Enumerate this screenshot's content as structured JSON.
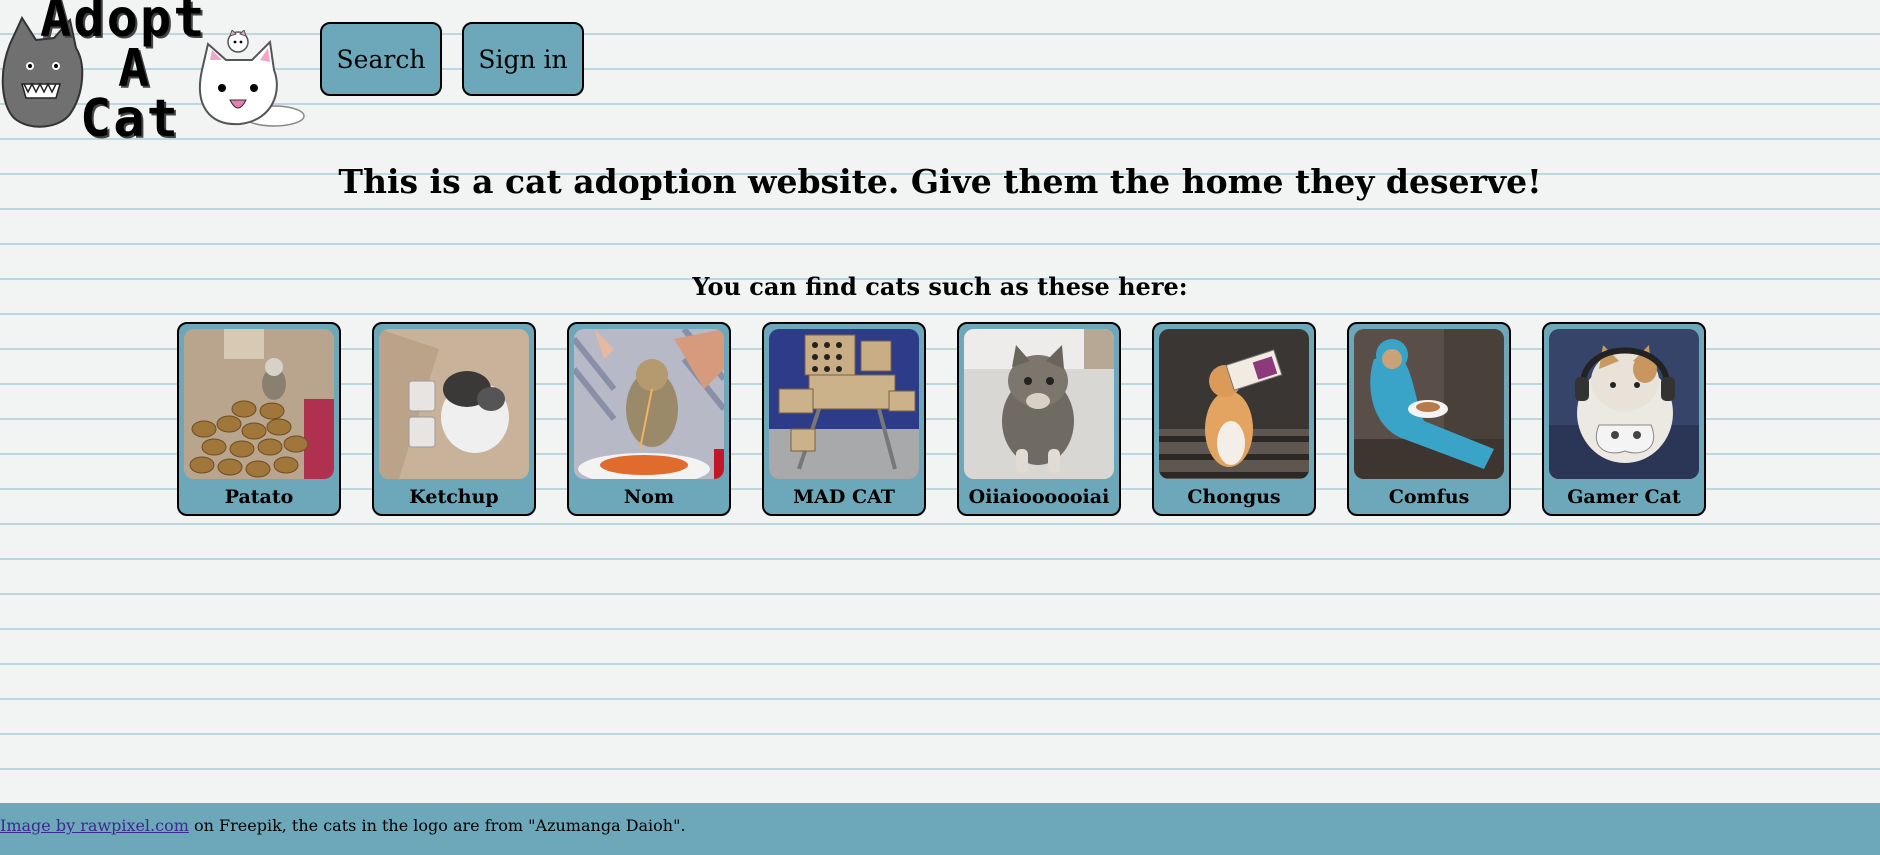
{
  "logo": {
    "line1": "Adopt",
    "line2": "A",
    "line3": "Cat"
  },
  "nav": {
    "search_label": "Search",
    "signin_label": "Sign in"
  },
  "headline": "This is a cat adoption website. Give them the home they deserve!",
  "subheading": "You can find cats such as these here:",
  "cats": [
    {
      "name": "Patato",
      "icon": "cat-on-potatoes-photo"
    },
    {
      "name": "Ketchup",
      "icon": "kitten-with-ketchup-packets-photo"
    },
    {
      "name": "Nom",
      "icon": "cat-eating-spaghetti-photo"
    },
    {
      "name": "MAD CAT",
      "icon": "cat-in-cardboard-mech-photo"
    },
    {
      "name": "Oiiaioooooiai",
      "icon": "tabby-cat-standing-photo"
    },
    {
      "name": "Chongus",
      "icon": "cat-drinking-from-carton-photo"
    },
    {
      "name": "Comfus",
      "icon": "cat-in-blue-onesie-photo"
    },
    {
      "name": "Gamer Cat",
      "icon": "cat-with-headset-and-controller-photo"
    }
  ],
  "footer": {
    "link_text": "Image by rawpixel.com",
    "rest_text": " on Freepik, the cats in the logo are from \"Azumanga Daioh\"."
  },
  "colors": {
    "accent": "#6ca8b9",
    "background": "#f2f4f3",
    "rule_lines": "#bcd8df",
    "link": "#3b2b8c"
  }
}
